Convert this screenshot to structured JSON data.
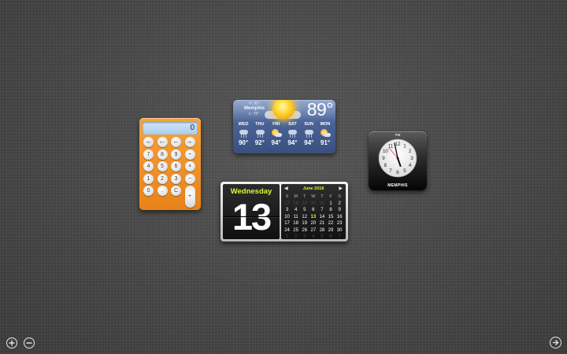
{
  "calculator": {
    "display": "0",
    "keys": [
      "mc",
      "m+",
      "m-",
      "mr",
      "7",
      "8",
      "9",
      "÷",
      "4",
      "5",
      "6",
      "×",
      "1",
      "2",
      "3",
      "−",
      "0",
      ".",
      "C",
      "+",
      "="
    ]
  },
  "weather": {
    "city": "Memphis",
    "hi": "H: 90°",
    "lo": "L: 76°",
    "current_temp": "89°",
    "forecast": [
      {
        "day": "WED",
        "temp": "90°",
        "icon": "rain-cloud-icon"
      },
      {
        "day": "THU",
        "temp": "92°",
        "icon": "rain-cloud-icon"
      },
      {
        "day": "FRI",
        "temp": "94°",
        "icon": "partly-sunny-icon"
      },
      {
        "day": "SAT",
        "temp": "94°",
        "icon": "rain-cloud-icon"
      },
      {
        "day": "SUN",
        "temp": "94°",
        "icon": "rain-cloud-icon"
      },
      {
        "day": "MON",
        "temp": "91°",
        "icon": "partly-sunny-icon"
      }
    ]
  },
  "calendar": {
    "weekday": "Wednesday",
    "day": "13",
    "month_title": "June 2018",
    "headers": [
      "S",
      "M",
      "T",
      "W",
      "T",
      "F",
      "S"
    ],
    "weeks": [
      [
        "27",
        "28",
        "29",
        "30",
        "31",
        "1",
        "2"
      ],
      [
        "3",
        "4",
        "5",
        "6",
        "7",
        "8",
        "9"
      ],
      [
        "10",
        "11",
        "12",
        "13",
        "14",
        "15",
        "16"
      ],
      [
        "17",
        "18",
        "19",
        "20",
        "21",
        "22",
        "23"
      ],
      [
        "24",
        "25",
        "26",
        "27",
        "28",
        "29",
        "30"
      ],
      [
        "1",
        "2",
        "3",
        "4",
        "5",
        "6",
        "7"
      ]
    ],
    "today": "13"
  },
  "clock": {
    "ampm": "PM",
    "city": "MEMPHIS",
    "numerals": [
      "12",
      "1",
      "2",
      "3",
      "4",
      "5",
      "6",
      "7",
      "8",
      "9",
      "10",
      "11"
    ]
  },
  "controls": {
    "add_icon": "plus-circle-icon",
    "remove_icon": "minus-circle-icon",
    "exit_icon": "arrow-circle-icon"
  }
}
